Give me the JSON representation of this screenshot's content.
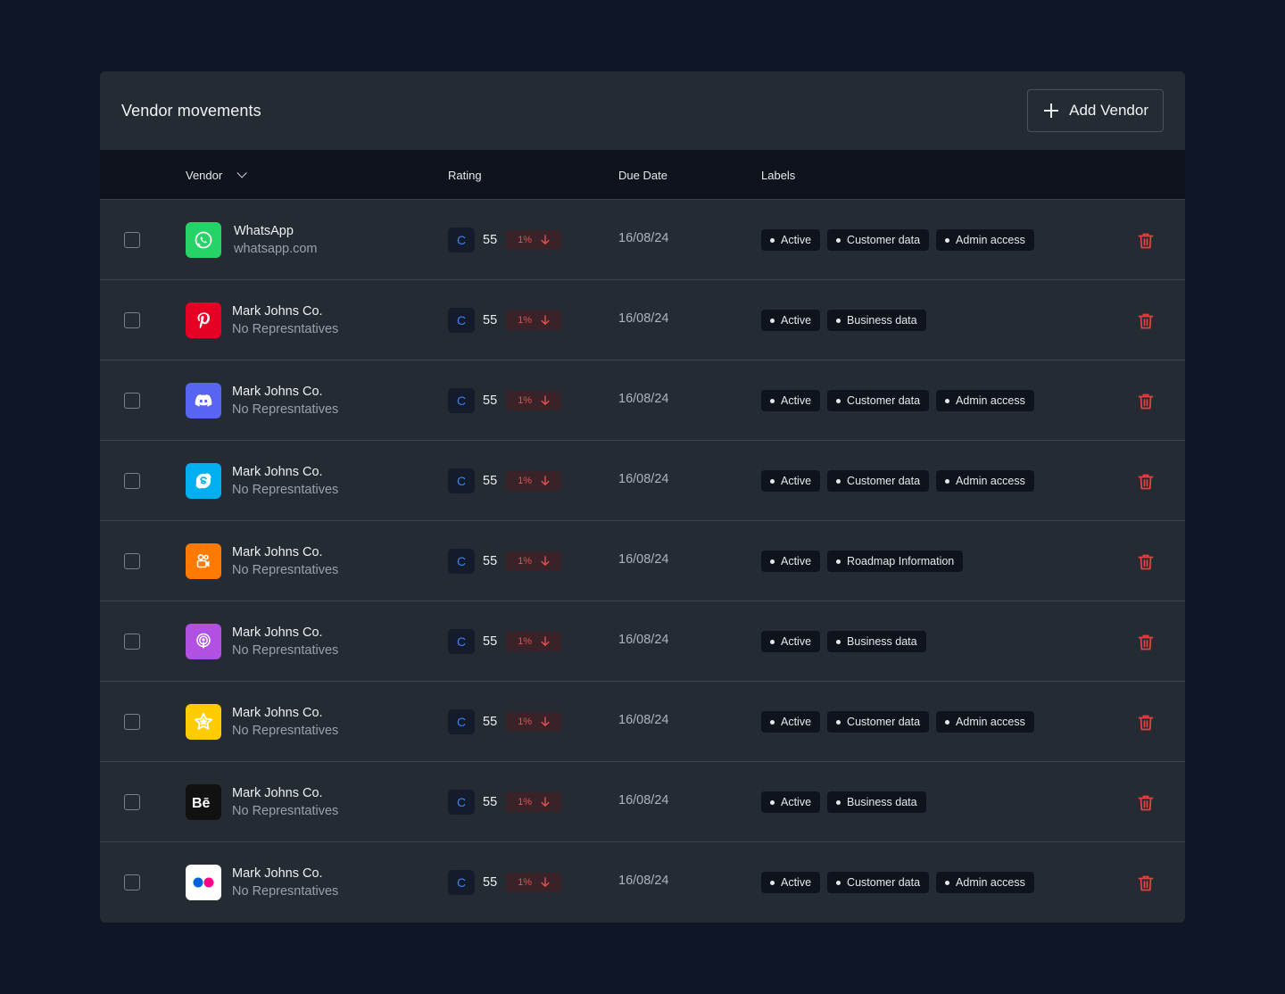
{
  "header": {
    "title": "Vendor movements",
    "add_label": "Add Vendor"
  },
  "columns": {
    "vendor": "Vendor",
    "rating": "Rating",
    "due_date": "Due Date",
    "labels": "Labels"
  },
  "colors": {
    "accent": "#3b82f6",
    "danger": "#e05252"
  },
  "rows": [
    {
      "logo": "whatsapp-logo",
      "name": "WhatsApp",
      "sub": "whatsapp.com",
      "grade": "C",
      "score": "55",
      "trend": "1%",
      "due": "16/08/24",
      "labels": [
        "Active",
        "Customer data",
        "Admin access"
      ]
    },
    {
      "logo": "pinterest-logo",
      "name": "Mark Johns Co.",
      "sub": "No Represntatives",
      "grade": "C",
      "score": "55",
      "trend": "1%",
      "due": "16/08/24",
      "labels": [
        "Active",
        "Business data"
      ]
    },
    {
      "logo": "discord-logo",
      "name": "Mark Johns Co.",
      "sub": "No Represntatives",
      "grade": "C",
      "score": "55",
      "trend": "1%",
      "due": "16/08/24",
      "labels": [
        "Active",
        "Customer data",
        "Admin access"
      ]
    },
    {
      "logo": "skype-logo",
      "name": "Mark Johns Co.",
      "sub": "No Represntatives",
      "grade": "C",
      "score": "55",
      "trend": "1%",
      "due": "16/08/24",
      "labels": [
        "Active",
        "Customer data",
        "Admin access"
      ]
    },
    {
      "logo": "clips-logo",
      "name": "Mark Johns Co.",
      "sub": "No Represntatives",
      "grade": "C",
      "score": "55",
      "trend": "1%",
      "due": "16/08/24",
      "labels": [
        "Active",
        "Roadmap Information"
      ]
    },
    {
      "logo": "podcasts-logo",
      "name": "Mark Johns Co.",
      "sub": "No Represntatives",
      "grade": "C",
      "score": "55",
      "trend": "1%",
      "due": "16/08/24",
      "labels": [
        "Active",
        "Business data"
      ]
    },
    {
      "logo": "star-logo",
      "name": "Mark Johns Co.",
      "sub": "No Represntatives",
      "grade": "C",
      "score": "55",
      "trend": "1%",
      "due": "16/08/24",
      "labels": [
        "Active",
        "Customer data",
        "Admin access"
      ]
    },
    {
      "logo": "behance-logo",
      "name": "Mark Johns Co.",
      "sub": "No Represntatives",
      "grade": "C",
      "score": "55",
      "trend": "1%",
      "due": "16/08/24",
      "labels": [
        "Active",
        "Business data"
      ]
    },
    {
      "logo": "flickr-logo",
      "name": "Mark Johns Co.",
      "sub": "No Represntatives",
      "grade": "C",
      "score": "55",
      "trend": "1%",
      "due": "16/08/24",
      "labels": [
        "Active",
        "Customer data",
        "Admin access"
      ]
    }
  ]
}
